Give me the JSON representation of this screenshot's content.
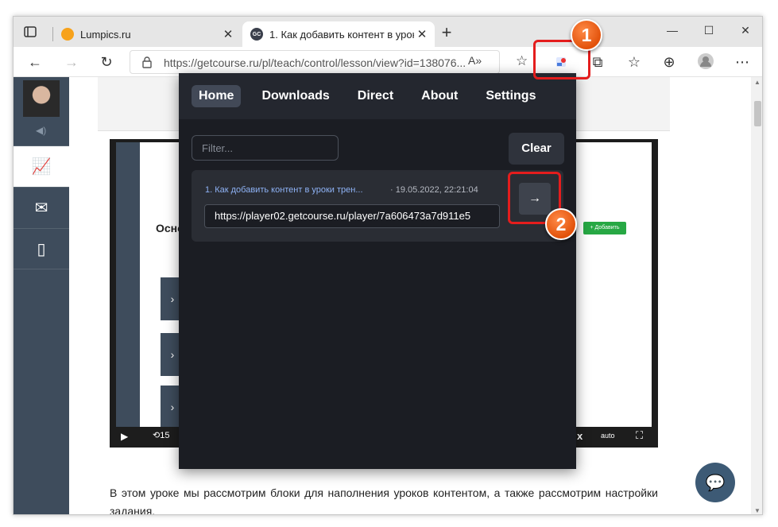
{
  "browser": {
    "tabs": [
      {
        "title": "Lumpics.ru",
        "favicon": "lumpics-orange-icon"
      },
      {
        "title": "1. Как добавить контент в уроки",
        "favicon": "gc-favicon"
      }
    ],
    "new_tab": "+",
    "window_controls": [
      "—",
      "☐",
      "✕"
    ],
    "url": "https://getcourse.ru/pl/teach/control/lesson/view?id=138076..."
  },
  "page": {
    "video_mini": {
      "title_fragment": "Осно",
      "add_button": "+ Добавить",
      "auto_label": "auto",
      "speed_label": "x"
    },
    "article_text": "В этом уроке мы рассмотрим блоки для наполнения уроков контентом, а также рассмотрим настройки задания."
  },
  "popup": {
    "nav": [
      "Home",
      "Downloads",
      "Direct",
      "About",
      "Settings"
    ],
    "filter_placeholder": "Filter...",
    "clear_label": "Clear",
    "items": [
      {
        "title": "1. Как добавить контент в уроки трен...",
        "date": "· 19.05.2022, 22:21:04",
        "url": "https://player02.getcourse.ru/player/7a606473a7d911e5"
      }
    ]
  },
  "callouts": {
    "one": "1",
    "two": "2"
  },
  "colors": {
    "highlight": "#e41d1d",
    "badge": "#e2520b",
    "popup_bg": "#1b1d23",
    "sidebar": "#3e4c5c"
  }
}
